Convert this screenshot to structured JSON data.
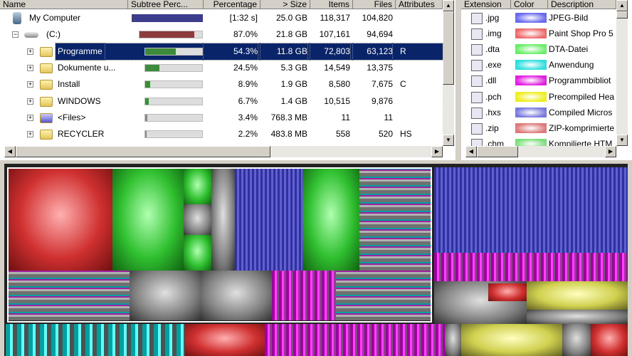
{
  "tree": {
    "columns": [
      "Name",
      "Subtree Perc...",
      "Percentage",
      "> Size",
      "Items",
      "Files",
      "Attributes"
    ],
    "rows": [
      {
        "name": "My Computer",
        "subtree": 1.0,
        "pct": "[1:32 s]",
        "size": "25.0 GB",
        "items": "118,317",
        "files": "104,820",
        "attr": "",
        "color": "#3c3c8c"
      },
      {
        "name": "(C:)",
        "subtree": 0.87,
        "pct": "87.0%",
        "size": "21.8 GB",
        "items": "107,161",
        "files": "94,694",
        "attr": "",
        "color": "#8c3c3c"
      },
      {
        "name": "Programme",
        "subtree": 0.543,
        "pct": "54.3%",
        "size": "11.8 GB",
        "items": "72,803",
        "files": "63,123",
        "attr": "R",
        "color": "#3c8c3c",
        "selected": true
      },
      {
        "name": "Dokumente u...",
        "subtree": 0.245,
        "pct": "24.5%",
        "size": "5.3 GB",
        "items": "14,549",
        "files": "13,375",
        "attr": "",
        "color": "#3c8c3c"
      },
      {
        "name": "Install",
        "subtree": 0.089,
        "pct": "8.9%",
        "size": "1.9 GB",
        "items": "8,580",
        "files": "7,675",
        "attr": "C",
        "color": "#3c8c3c"
      },
      {
        "name": "WINDOWS",
        "subtree": 0.067,
        "pct": "6.7%",
        "size": "1.4 GB",
        "items": "10,515",
        "files": "9,876",
        "attr": "",
        "color": "#3c8c3c"
      },
      {
        "name": "<Files>",
        "subtree": 0.034,
        "pct": "3.4%",
        "size": "768.3 MB",
        "items": "11",
        "files": "11",
        "attr": "",
        "color": "#888"
      },
      {
        "name": "RECYCLER",
        "subtree": 0.022,
        "pct": "2.2%",
        "size": "483.8 MB",
        "items": "558",
        "files": "520",
        "attr": "HS",
        "color": "#888"
      }
    ]
  },
  "extensions": {
    "columns": [
      "Extension",
      "Color",
      "Description"
    ],
    "rows": [
      {
        "ext": ".jpg",
        "color": "#6a6aee",
        "desc": "JPEG-Bild"
      },
      {
        "ext": ".img",
        "color": "#ee6a6a",
        "desc": "Paint Shop Pro 5"
      },
      {
        "ext": ".dta",
        "color": "#6aee6a",
        "desc": "DTA-Datei"
      },
      {
        "ext": ".exe",
        "color": "#30dede",
        "desc": "Anwendung"
      },
      {
        "ext": ".dll",
        "color": "#e020e0",
        "desc": "Programmbibliot"
      },
      {
        "ext": ".pch",
        "color": "#eeee20",
        "desc": "Precompiled Hea"
      },
      {
        "ext": ".hxs",
        "color": "#7a7ade",
        "desc": "Compiled Micros"
      },
      {
        "ext": ".zip",
        "color": "#de7a7a",
        "desc": "ZIP-komprimierte"
      },
      {
        "ext": ".chm",
        "color": "#7ade7a",
        "desc": "Kompilierte HTM"
      }
    ]
  }
}
